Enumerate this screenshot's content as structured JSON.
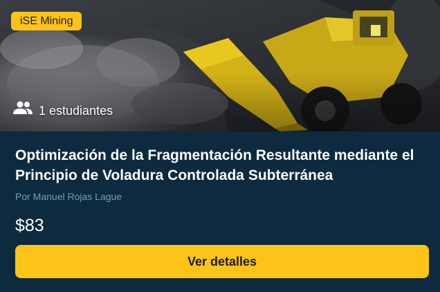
{
  "card": {
    "badge": "iSE Mining",
    "students": "1 estudiantes",
    "title": "Optimización de la Fragmentación Resultante mediante el Principio de Voladura Controlada Subterránea",
    "author": "Por Manuel Rojas Lague",
    "price": "$83",
    "cta_label": "Ver detalles",
    "students_icon": "people-icon"
  },
  "colors": {
    "accent": "#fcc419",
    "background": "#0d2a3f",
    "author_text": "#6f9fc0"
  }
}
